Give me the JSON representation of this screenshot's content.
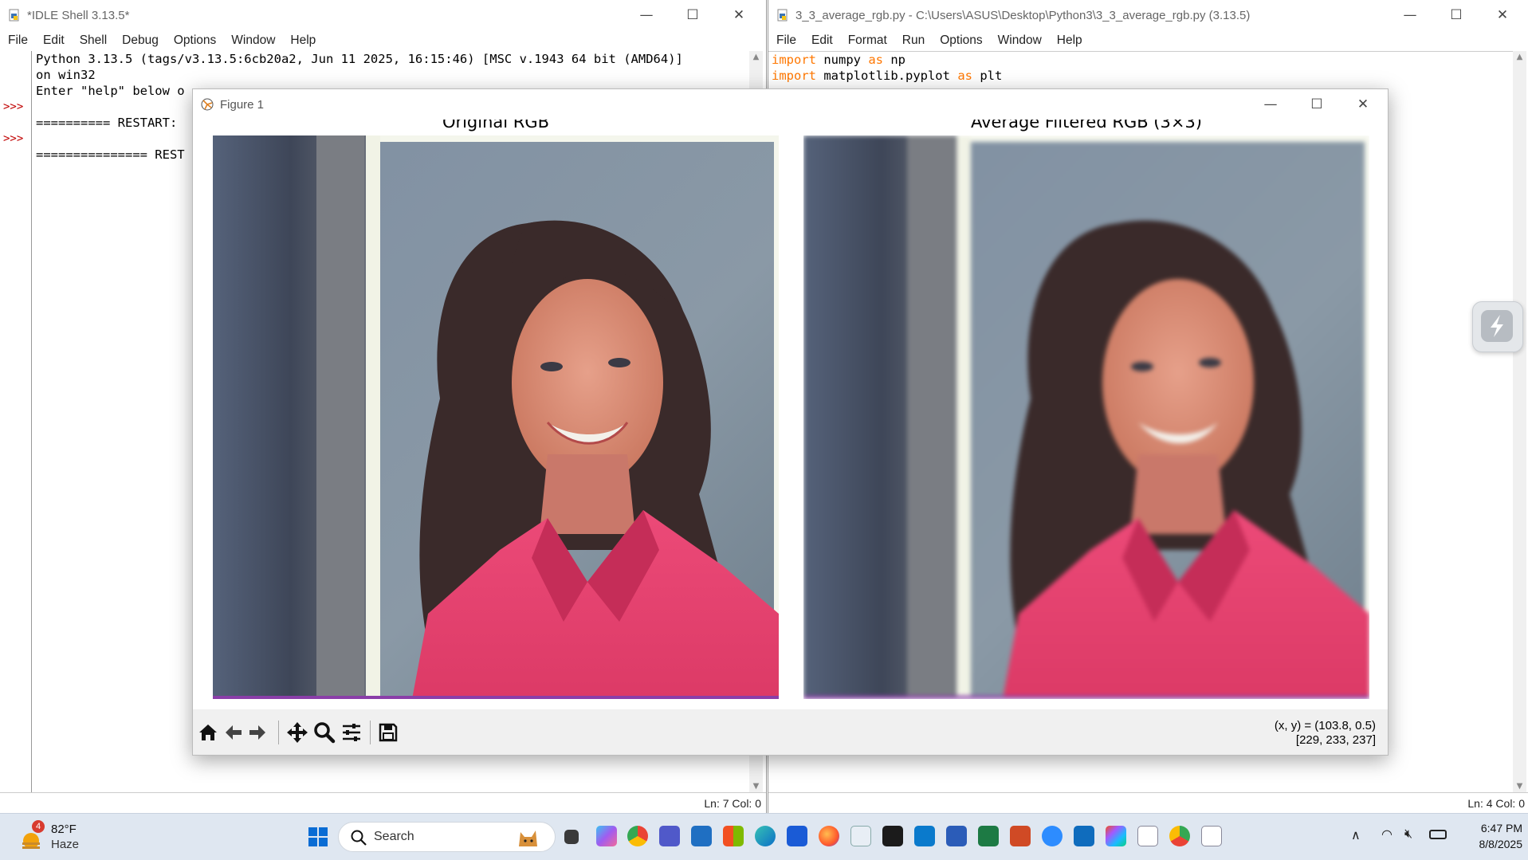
{
  "shell": {
    "title": "*IDLE Shell 3.13.5*",
    "menu": [
      "File",
      "Edit",
      "Shell",
      "Debug",
      "Options",
      "Window",
      "Help"
    ],
    "lines": [
      "Python 3.13.5 (tags/v3.13.5:6cb20a2, Jun 11 2025, 16:15:46) [MSC v.1943 64 bit (AMD64)]",
      "on win32",
      "Enter \"help\" below o",
      "",
      "========== RESTART:",
      "",
      "=============== REST"
    ],
    "prompts": [
      ">>>",
      ">>>"
    ],
    "status": "Ln: 7   Col: 0"
  },
  "editor": {
    "title": "3_3_average_rgb.py - C:\\Users\\ASUS\\Desktop\\Python3\\3_3_average_rgb.py (3.13.5)",
    "menu": [
      "File",
      "Edit",
      "Format",
      "Run",
      "Options",
      "Window",
      "Help"
    ],
    "line1": {
      "kw": "import",
      "rest": " numpy ",
      "kw2": "as",
      "rest2": " np"
    },
    "line2": {
      "kw": "import",
      "rest": " matplotlib.pyplot ",
      "kw2": "as",
      "rest2": " plt"
    },
    "status": "Ln: 4   Col: 0"
  },
  "figure": {
    "title": "Figure 1",
    "ax1_title": "Original RGB",
    "ax2_title": "Average Filtered RGB (3×3)",
    "coords_line1": "(x, y) = (103.8, 0.5)",
    "coords_line2": "[229, 233, 237]",
    "toolbar": [
      "home-icon",
      "back-icon",
      "forward-icon",
      "pan-icon",
      "zoom-icon",
      "configure-subplots-icon",
      "save-icon"
    ]
  },
  "taskbar": {
    "weather_temp": "82°F",
    "weather_desc": "Haze",
    "weather_badge": "4",
    "search_placeholder": "Search",
    "time": "6:47 PM",
    "date": "8/8/2025"
  },
  "colors": {
    "keyword": "#ff7700",
    "prompt": "#c00000",
    "taskbar_bg": "#dfe7f1",
    "shirt_pink": "#e6416e"
  }
}
